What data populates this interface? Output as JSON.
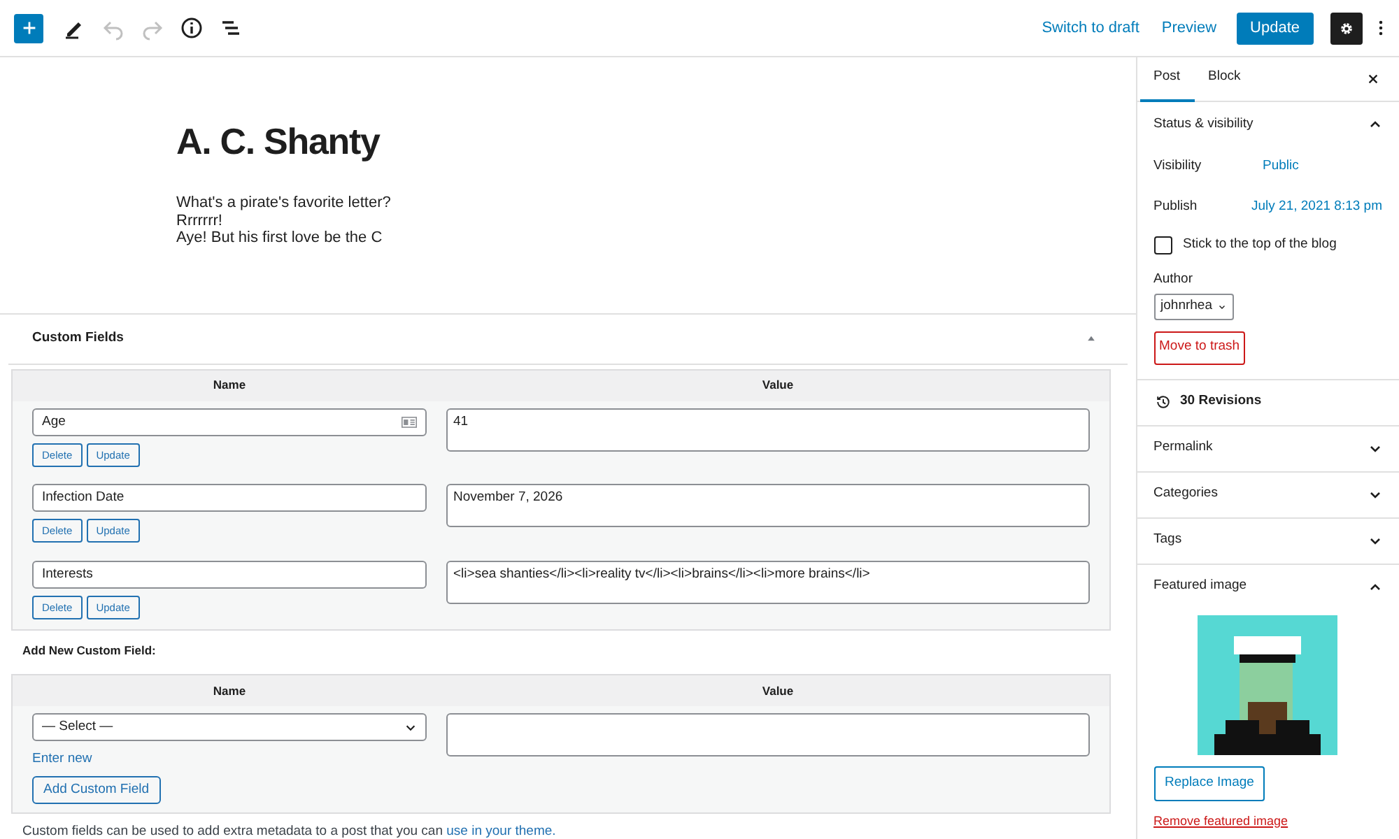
{
  "toolbar": {
    "left": [
      {
        "kind": "add",
        "disabled": false
      },
      {
        "kind": "pencil",
        "disabled": false
      },
      {
        "kind": "undo",
        "disabled": true
      },
      {
        "kind": "redo",
        "disabled": true
      },
      {
        "kind": "info",
        "disabled": false
      },
      {
        "kind": "outline",
        "disabled": false
      }
    ],
    "links": [
      "Switch to draft",
      "Preview"
    ],
    "primary": "Update",
    "settings_selected": true
  },
  "post": {
    "title": "A. C. Shanty",
    "lines": [
      "What's a pirate's favorite letter?",
      "Rrrrrrr!",
      "Aye! But his first love be the C"
    ]
  },
  "custom_fields": {
    "title": "Custom Fields",
    "expanded": true,
    "columns": [
      "Name",
      "Value"
    ],
    "rows": [
      {
        "name": "Age",
        "value": "41",
        "autofill": true,
        "buttons": [
          "Delete",
          "Update"
        ]
      },
      {
        "name": "Infection Date",
        "value": "November 7, 2026",
        "autofill": false,
        "buttons": [
          "Delete",
          "Update"
        ]
      },
      {
        "name": "Interests",
        "value": "<li>sea shanties</li><li>reality tv</li><li>brains</li><li>more brains</li>",
        "autofill": false,
        "buttons": [
          "Delete",
          "Update"
        ]
      }
    ],
    "add_new": {
      "label": "Add New Custom Field:",
      "columns": [
        "Name",
        "Value"
      ],
      "select": "— Select —",
      "enter_new": "Enter new",
      "button": "Add Custom Field"
    },
    "note": "Custom fields can be used to add extra metadata to a post that you can",
    "note_link": "use in your theme."
  },
  "sidebar": {
    "tabs": [
      {
        "label": "Post",
        "selected": true
      },
      {
        "label": "Block",
        "selected": false
      }
    ],
    "panels": [
      {
        "kind": "status",
        "title": "Status & visibility",
        "expanded": true,
        "rows": [
          {
            "label": "Visibility",
            "value": "Public"
          },
          {
            "label": "Publish",
            "value": "July 21, 2021 8:13 pm"
          }
        ],
        "sticky": {
          "label": "Stick to the top of the blog",
          "checked": false
        },
        "author_label": "Author",
        "author": "johnrhea",
        "trash": "Move to trash"
      },
      {
        "kind": "revisions",
        "title": "30 Revisions"
      },
      {
        "kind": "section",
        "title": "Permalink",
        "expanded": false
      },
      {
        "kind": "section",
        "title": "Categories",
        "expanded": false
      },
      {
        "kind": "section",
        "title": "Tags",
        "expanded": false
      },
      {
        "title": "Featured image",
        "expanded": true,
        "replace": "Replace Image",
        "remove": "Remove featured image"
      }
    ]
  }
}
